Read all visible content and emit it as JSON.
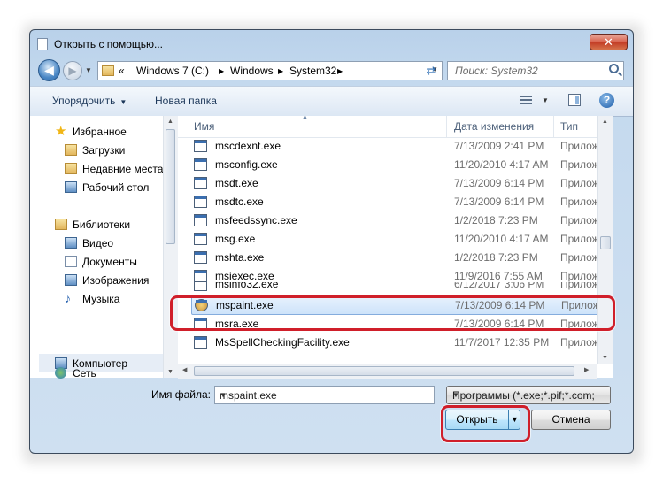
{
  "window": {
    "title": "Открыть с помощью...",
    "close_label": "✕"
  },
  "navbar": {
    "breadcrumbs": [
      "«",
      "Windows 7 (C:)",
      "Windows",
      "System32"
    ],
    "search_placeholder": "Поиск: System32"
  },
  "toolbar": {
    "organize": "Упорядочить",
    "new_folder": "Новая папка"
  },
  "sidebar": {
    "favorites": "Избранное",
    "downloads": "Загрузки",
    "recent": "Недавние места",
    "desktop": "Рабочий стол",
    "libraries": "Библиотеки",
    "videos": "Видео",
    "documents": "Документы",
    "pictures": "Изображения",
    "music": "Музыка",
    "computer": "Компьютер",
    "network": "Сеть"
  },
  "columns": {
    "name": "Имя",
    "date": "Дата изменения",
    "type": "Тип"
  },
  "files": [
    {
      "name": "mscdexnt.exe",
      "date": "7/13/2009 2:41 PM",
      "type": "Приложение"
    },
    {
      "name": "msconfig.exe",
      "date": "11/20/2010 4:17 AM",
      "type": "Приложение"
    },
    {
      "name": "msdt.exe",
      "date": "7/13/2009 6:14 PM",
      "type": "Приложение"
    },
    {
      "name": "msdtc.exe",
      "date": "7/13/2009 6:14 PM",
      "type": "Приложение"
    },
    {
      "name": "msfeedssync.exe",
      "date": "1/2/2018 7:23 PM",
      "type": "Приложение"
    },
    {
      "name": "msg.exe",
      "date": "11/20/2010 4:17 AM",
      "type": "Приложение"
    },
    {
      "name": "mshta.exe",
      "date": "1/2/2018 7:23 PM",
      "type": "Приложение"
    },
    {
      "name": "msiexec.exe",
      "date": "11/9/2016 7:55 AM",
      "type": "Приложение"
    },
    {
      "name": "msinfo32.exe",
      "date": "6/12/2017 3:06 PM",
      "type": "Приложение"
    },
    {
      "name": "mspaint.exe",
      "date": "7/13/2009 6:14 PM",
      "type": "Приложение"
    },
    {
      "name": "msra.exe",
      "date": "7/13/2009 6:14 PM",
      "type": "Приложение"
    },
    {
      "name": "MsSpellCheckingFacility.exe",
      "date": "11/7/2017 12:35 PM",
      "type": "Приложение"
    }
  ],
  "bottom": {
    "filename_label": "Имя файла:",
    "filename_value": "mspaint.exe",
    "filter_value": "Программы (*.exe;*.pif;*.com;",
    "open_button": "Открыть",
    "cancel_button": "Отмена"
  },
  "colors": {
    "highlight": "#d01f2a",
    "selection": "#cde3fa",
    "window_frame": "#c4d9ee"
  }
}
